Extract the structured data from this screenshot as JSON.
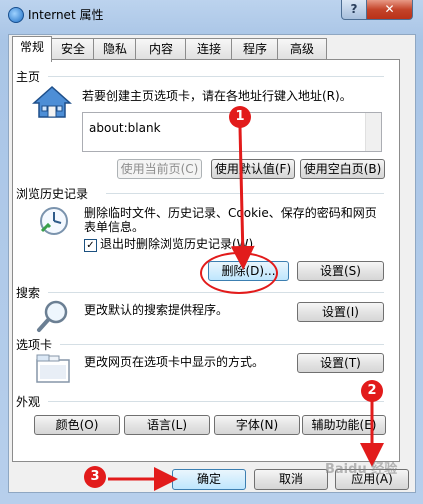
{
  "window": {
    "title": "Internet 属性",
    "help_label": "?",
    "close_label": "✕"
  },
  "tabs": [
    "常规",
    "安全",
    "隐私",
    "内容",
    "连接",
    "程序",
    "高级"
  ],
  "home": {
    "group_label": "主页",
    "desc": "若要创建主页选项卡，请在各地址行键入地址(R)。",
    "address": "about:blank",
    "btn_current": "使用当前页(C)",
    "btn_default": "使用默认值(F)",
    "btn_blank": "使用空白页(B)"
  },
  "history": {
    "group_label": "浏览历史记录",
    "desc1": "删除临时文件、历史记录、Cookie、保存的密码和网页",
    "desc2": "表单信息。",
    "checkbox_label": "退出时删除浏览历史记录(W)",
    "checkbox_checked": "✓",
    "btn_delete": "删除(D)...",
    "btn_settings": "设置(S)"
  },
  "search": {
    "group_label": "搜索",
    "desc": "更改默认的搜索提供程序。",
    "btn_settings": "设置(I)"
  },
  "tabs_group": {
    "group_label": "选项卡",
    "desc": "更改网页在选项卡中显示的方式。",
    "btn_settings": "设置(T)"
  },
  "appearance": {
    "group_label": "外观",
    "btn_colors": "颜色(O)",
    "btn_languages": "语言(L)",
    "btn_fonts": "字体(N)",
    "btn_accessibility": "辅助功能(E)"
  },
  "footer": {
    "ok": "确定",
    "cancel": "取消",
    "apply": "应用(A)"
  },
  "annotations": {
    "one": "1",
    "two": "2",
    "three": "3",
    "color": "#e21b1b"
  },
  "watermark": "Baidu 经验"
}
